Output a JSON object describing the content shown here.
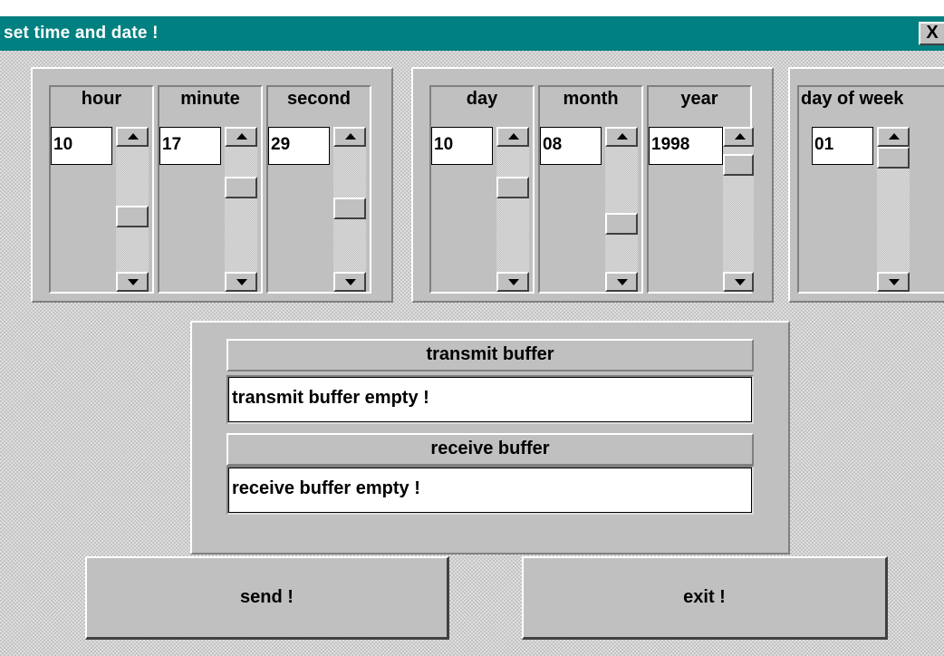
{
  "window": {
    "title": "set time and date !",
    "close_glyph": "X",
    "close_icon": "close-icon"
  },
  "time": {
    "hour": {
      "label": "hour",
      "value": "10",
      "slider_fraction": 0.57
    },
    "minute": {
      "label": "minute",
      "value": "17",
      "slider_fraction": 0.29
    },
    "second": {
      "label": "second",
      "value": "29",
      "slider_fraction": 0.49
    }
  },
  "date": {
    "day": {
      "label": "day",
      "value": "10",
      "slider_fraction": 0.29
    },
    "month": {
      "label": "month",
      "value": "08",
      "slider_fraction": 0.64
    },
    "year": {
      "label": "year",
      "value": "1998",
      "slider_fraction": 0.07
    }
  },
  "weekday": {
    "label": "day of week",
    "value": "01",
    "slider_fraction": 0.0
  },
  "buffers": {
    "transmit_label": "transmit buffer",
    "transmit_value": "transmit buffer empty !",
    "receive_label": "receive buffer",
    "receive_value": "receive buffer empty !"
  },
  "buttons": {
    "send": "send !",
    "exit": "exit !"
  }
}
